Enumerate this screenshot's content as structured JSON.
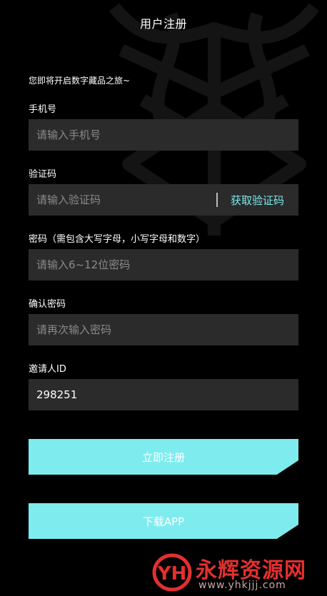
{
  "header": {
    "title": "用户注册"
  },
  "intro": {
    "text": "您即将开启数字藏品之旅~"
  },
  "form": {
    "phone": {
      "label": "手机号",
      "placeholder": "请输入手机号",
      "value": ""
    },
    "code": {
      "label": "验证码",
      "placeholder": "请输入验证码",
      "value": "",
      "action_label": "获取验证码"
    },
    "password": {
      "label": "密码（需包含大写字母，小写字母和数字）",
      "placeholder": "请输入6~12位密码",
      "value": ""
    },
    "confirm": {
      "label": "确认密码",
      "placeholder": "请再次输入密码",
      "value": ""
    },
    "inviter": {
      "label": "邀请人ID",
      "placeholder": "",
      "value": "298251"
    }
  },
  "buttons": {
    "register": "立即注册",
    "download": "下载APP"
  },
  "watermark": {
    "logo_text": "YH",
    "name": "永辉资源网",
    "url": "www.yhkjjj.com"
  },
  "colors": {
    "background": "#000000",
    "field_bg": "#2b2b2b",
    "accent": "#7eecee",
    "accent_text": "#7ce9ec",
    "watermark_red": "#e3302e"
  },
  "icons": {
    "background_emblem": "emblem-icon",
    "watermark_logo": "yh-logo-icon"
  }
}
